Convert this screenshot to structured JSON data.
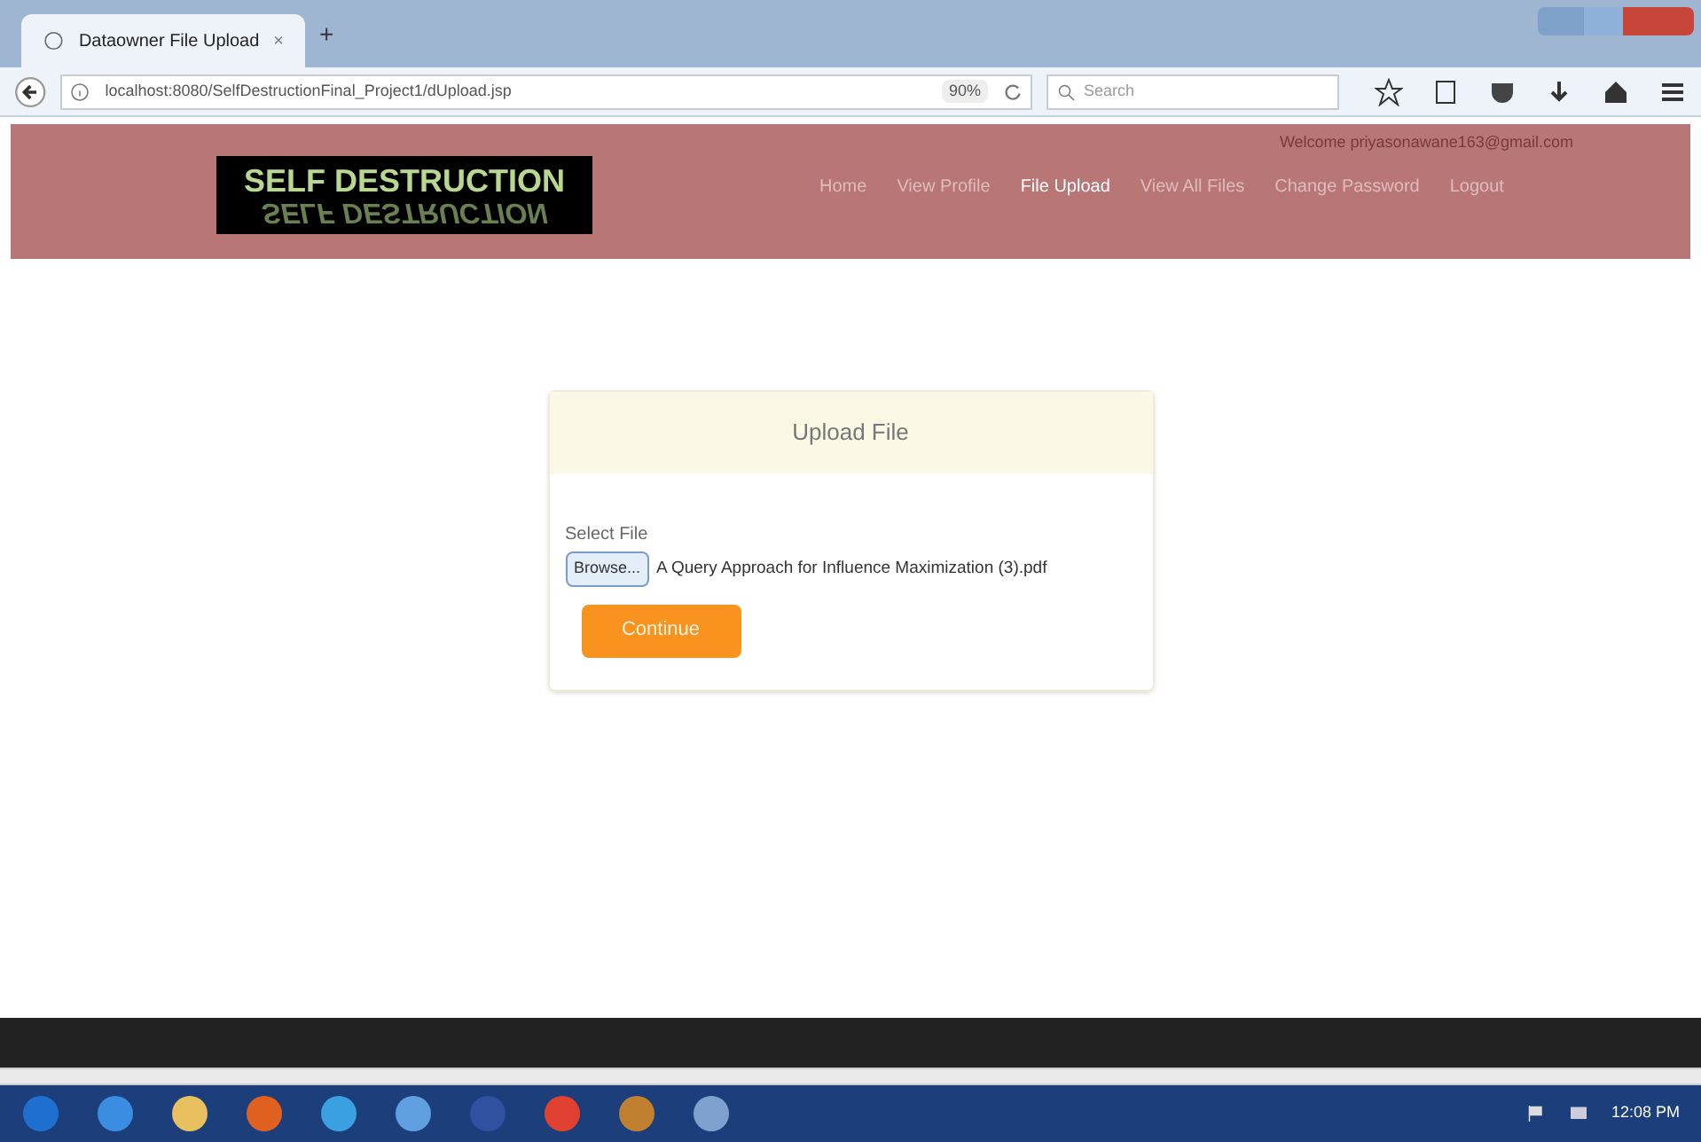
{
  "browser": {
    "tab_title": "Dataowner File Upload",
    "tab_close": "×",
    "new_tab": "+",
    "url": "localhost:8080/SelfDestructionFinal_Project1/dUpload.jsp",
    "zoom": "90%",
    "search_placeholder": "Search"
  },
  "header": {
    "logo": "SELF DESTRUCTION",
    "logo_reflection": "SELF DESTRUCTION",
    "welcome": "Welcome priyasonawane163@gmail.com",
    "nav": [
      {
        "label": "Home",
        "selected": false
      },
      {
        "label": "View Profile",
        "selected": false
      },
      {
        "label": "File Upload",
        "selected": true
      },
      {
        "label": "View All Files",
        "selected": false
      },
      {
        "label": "Change Password",
        "selected": false
      },
      {
        "label": "Logout",
        "selected": false
      }
    ]
  },
  "upload_card": {
    "title": "Upload File",
    "field_label": "Select File",
    "browse_button": "Browse...",
    "file_name": "A Query Approach for Influence Maximization (3).pdf",
    "submit": "Continue"
  },
  "taskbar": {
    "time": "12:08 PM"
  }
}
